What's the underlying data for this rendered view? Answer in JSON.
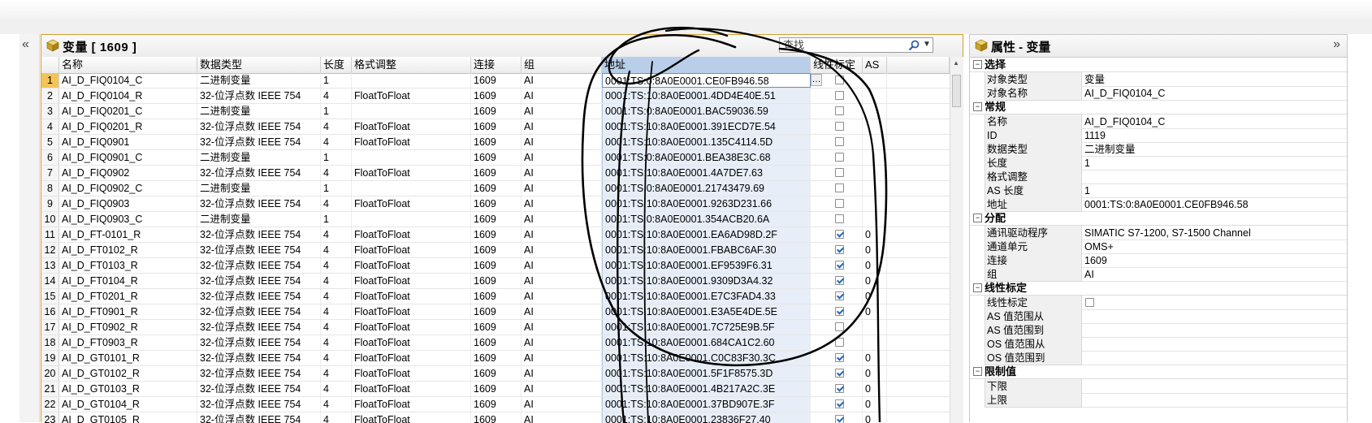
{
  "editor": {
    "title": "变量 [ 1609 ]",
    "search_placeholder": "查找",
    "columns": [
      "",
      "名称",
      "数据类型",
      "长度",
      "格式调整",
      "连接",
      "组",
      "地址",
      "线性标定",
      "AS"
    ],
    "rows": [
      {
        "n": "1",
        "name": "AI_D_FIQ0104_C",
        "type": "二进制变量",
        "len": "1",
        "fmt": "",
        "conn": "1609",
        "grp": "AI",
        "addr": "0001:TS:0:8A0E0001.CE0FB946.58",
        "lin": false,
        "as": ""
      },
      {
        "n": "2",
        "name": "AI_D_FIQ0104_R",
        "type": "32-位浮点数 IEEE 754",
        "len": "4",
        "fmt": "FloatToFloat",
        "conn": "1609",
        "grp": "AI",
        "addr": "0001:TS:10:8A0E0001.4DD4E40E.51",
        "lin": false,
        "as": ""
      },
      {
        "n": "3",
        "name": "AI_D_FIQ0201_C",
        "type": "二进制变量",
        "len": "1",
        "fmt": "",
        "conn": "1609",
        "grp": "AI",
        "addr": "0001:TS:0:8A0E0001.BAC59036.59",
        "lin": false,
        "as": ""
      },
      {
        "n": "4",
        "name": "AI_D_FIQ0201_R",
        "type": "32-位浮点数 IEEE 754",
        "len": "4",
        "fmt": "FloatToFloat",
        "conn": "1609",
        "grp": "AI",
        "addr": "0001:TS:10:8A0E0001.391ECD7E.54",
        "lin": false,
        "as": ""
      },
      {
        "n": "5",
        "name": "AI_D_FIQ0901",
        "type": "32-位浮点数 IEEE 754",
        "len": "4",
        "fmt": "FloatToFloat",
        "conn": "1609",
        "grp": "AI",
        "addr": "0001:TS:10:8A0E0001.135C4114.5D",
        "lin": false,
        "as": ""
      },
      {
        "n": "6",
        "name": "AI_D_FIQ0901_C",
        "type": "二进制变量",
        "len": "1",
        "fmt": "",
        "conn": "1609",
        "grp": "AI",
        "addr": "0001:TS:0:8A0E0001.BEA38E3C.68",
        "lin": false,
        "as": ""
      },
      {
        "n": "7",
        "name": "AI_D_FIQ0902",
        "type": "32-位浮点数 IEEE 754",
        "len": "4",
        "fmt": "FloatToFloat",
        "conn": "1609",
        "grp": "AI",
        "addr": "0001:TS:10:8A0E0001.4A7DE7.63",
        "lin": false,
        "as": ""
      },
      {
        "n": "8",
        "name": "AI_D_FIQ0902_C",
        "type": "二进制变量",
        "len": "1",
        "fmt": "",
        "conn": "1609",
        "grp": "AI",
        "addr": "0001:TS:0:8A0E0001.21743479.69",
        "lin": false,
        "as": ""
      },
      {
        "n": "9",
        "name": "AI_D_FIQ0903",
        "type": "32-位浮点数 IEEE 754",
        "len": "4",
        "fmt": "FloatToFloat",
        "conn": "1609",
        "grp": "AI",
        "addr": "0001:TS:10:8A0E0001.9263D231.66",
        "lin": false,
        "as": ""
      },
      {
        "n": "10",
        "name": "AI_D_FIQ0903_C",
        "type": "二进制变量",
        "len": "1",
        "fmt": "",
        "conn": "1609",
        "grp": "AI",
        "addr": "0001:TS:0:8A0E0001.354ACB20.6A",
        "lin": false,
        "as": ""
      },
      {
        "n": "11",
        "name": "AI_D_FT-0101_R",
        "type": "32-位浮点数 IEEE 754",
        "len": "4",
        "fmt": "FloatToFloat",
        "conn": "1609",
        "grp": "AI",
        "addr": "0001:TS:10:8A0E0001.EA6AD98D.2F",
        "lin": true,
        "as": "0"
      },
      {
        "n": "12",
        "name": "AI_D_FT0102_R",
        "type": "32-位浮点数 IEEE 754",
        "len": "4",
        "fmt": "FloatToFloat",
        "conn": "1609",
        "grp": "AI",
        "addr": "0001:TS:10:8A0E0001.FBABC6AF.30",
        "lin": true,
        "as": "0"
      },
      {
        "n": "13",
        "name": "AI_D_FT0103_R",
        "type": "32-位浮点数 IEEE 754",
        "len": "4",
        "fmt": "FloatToFloat",
        "conn": "1609",
        "grp": "AI",
        "addr": "0001:TS:10:8A0E0001.EF9539F6.31",
        "lin": true,
        "as": "0"
      },
      {
        "n": "14",
        "name": "AI_D_FT0104_R",
        "type": "32-位浮点数 IEEE 754",
        "len": "4",
        "fmt": "FloatToFloat",
        "conn": "1609",
        "grp": "AI",
        "addr": "0001:TS:10:8A0E0001.9309D3A4.32",
        "lin": true,
        "as": "0"
      },
      {
        "n": "15",
        "name": "AI_D_FT0201_R",
        "type": "32-位浮点数 IEEE 754",
        "len": "4",
        "fmt": "FloatToFloat",
        "conn": "1609",
        "grp": "AI",
        "addr": "0001:TS:10:8A0E0001.E7C3FAD4.33",
        "lin": true,
        "as": "0"
      },
      {
        "n": "16",
        "name": "AI_D_FT0901_R",
        "type": "32-位浮点数 IEEE 754",
        "len": "4",
        "fmt": "FloatToFloat",
        "conn": "1609",
        "grp": "AI",
        "addr": "0001:TS:10:8A0E0001.E3A5E4DE.5E",
        "lin": true,
        "as": "0"
      },
      {
        "n": "17",
        "name": "AI_D_FT0902_R",
        "type": "32-位浮点数 IEEE 754",
        "len": "4",
        "fmt": "FloatToFloat",
        "conn": "1609",
        "grp": "AI",
        "addr": "0001:TS:10:8A0E0001.7C725E9B.5F",
        "lin": false,
        "as": ""
      },
      {
        "n": "18",
        "name": "AI_D_FT0903_R",
        "type": "32-位浮点数 IEEE 754",
        "len": "4",
        "fmt": "FloatToFloat",
        "conn": "1609",
        "grp": "AI",
        "addr": "0001:TS:10:8A0E0001.684CA1C2.60",
        "lin": false,
        "as": ""
      },
      {
        "n": "19",
        "name": "AI_D_GT0101_R",
        "type": "32-位浮点数 IEEE 754",
        "len": "4",
        "fmt": "FloatToFloat",
        "conn": "1609",
        "grp": "AI",
        "addr": "0001:TS:10:8A0E0001.C0C83F30.3C",
        "lin": true,
        "as": "0"
      },
      {
        "n": "20",
        "name": "AI_D_GT0102_R",
        "type": "32-位浮点数 IEEE 754",
        "len": "4",
        "fmt": "FloatToFloat",
        "conn": "1609",
        "grp": "AI",
        "addr": "0001:TS:10:8A0E0001.5F1F8575.3D",
        "lin": true,
        "as": "0"
      },
      {
        "n": "21",
        "name": "AI_D_GT0103_R",
        "type": "32-位浮点数 IEEE 754",
        "len": "4",
        "fmt": "FloatToFloat",
        "conn": "1609",
        "grp": "AI",
        "addr": "0001:TS:10:8A0E0001.4B217A2C.3E",
        "lin": true,
        "as": "0"
      },
      {
        "n": "22",
        "name": "AI_D_GT0104_R",
        "type": "32-位浮点数 IEEE 754",
        "len": "4",
        "fmt": "FloatToFloat",
        "conn": "1609",
        "grp": "AI",
        "addr": "0001:TS:10:8A0E0001.37BD907E.3F",
        "lin": true,
        "as": "0"
      },
      {
        "n": "23",
        "name": "AI_D_GT0105_R",
        "type": "32-位浮点数 IEEE 754",
        "len": "4",
        "fmt": "FloatToFloat",
        "conn": "1609",
        "grp": "AI",
        "addr": "0001:TS:10:8A0E0001.23836F27.40",
        "lin": true,
        "as": "0"
      }
    ]
  },
  "props": {
    "title": "属性 - 变量",
    "groups": [
      {
        "name": "选择",
        "items": [
          [
            "对象类型",
            "变量"
          ],
          [
            "对象名称",
            "AI_D_FIQ0104_C"
          ]
        ]
      },
      {
        "name": "常规",
        "items": [
          [
            "名称",
            "AI_D_FIQ0104_C"
          ],
          [
            "ID",
            "1119"
          ],
          [
            "数据类型",
            "二进制变量"
          ],
          [
            "长度",
            "1"
          ],
          [
            "格式调整",
            ""
          ],
          [
            "AS 长度",
            "1"
          ],
          [
            "地址",
            "0001:TS:0:8A0E0001.CE0FB946.58"
          ]
        ]
      },
      {
        "name": "分配",
        "items": [
          [
            "通讯驱动程序",
            "SIMATIC S7-1200, S7-1500 Channel"
          ],
          [
            "通道单元",
            "OMS+"
          ],
          [
            "连接",
            "1609"
          ],
          [
            "组",
            "AI"
          ]
        ]
      },
      {
        "name": "线性标定",
        "items": [
          [
            "线性标定",
            "__checkbox__"
          ],
          [
            "AS 值范围从",
            ""
          ],
          [
            "AS 值范围到",
            ""
          ],
          [
            "OS 值范围从",
            ""
          ],
          [
            "OS 值范围到",
            ""
          ]
        ]
      },
      {
        "name": "限制值",
        "items": [
          [
            "下限",
            ""
          ],
          [
            "上限",
            ""
          ]
        ]
      }
    ]
  },
  "colors": {
    "accent": "#d39d2e",
    "selected_row": "#f3c45a",
    "address_col": "#e7eef8",
    "check": "#2467b4"
  }
}
